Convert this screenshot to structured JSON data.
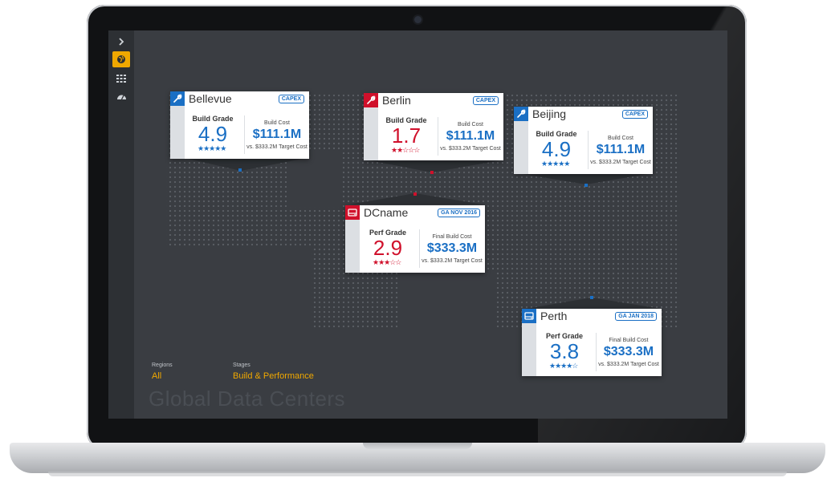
{
  "colors": {
    "accent": "#f0a800",
    "blue": "#1a6fc4",
    "red": "#d0102b",
    "screen_bg": "#3a3d42"
  },
  "sidebar": {
    "items": [
      {
        "name": "expand",
        "icon": "chevron-right-icon"
      },
      {
        "name": "globe",
        "icon": "globe-icon",
        "active": true
      },
      {
        "name": "grid",
        "icon": "grid-icon"
      },
      {
        "name": "dashboard",
        "icon": "gauge-icon"
      }
    ]
  },
  "filters": {
    "regions_label": "Regions",
    "regions_value": "All",
    "stages_label": "Stages",
    "stages_value": "Build & Performance"
  },
  "page_title": "Global Data Centers",
  "cards": [
    {
      "name": "Bellevue",
      "tag": "CAPEX",
      "icon": "wrench-icon",
      "grade_label": "Build Grade",
      "grade": "4.9",
      "stars": "★★★★★",
      "stars_filled": 4.5,
      "cost_label": "Build Cost",
      "cost": "$111.1M",
      "target": "vs. $333.2M Target Cost",
      "status": "good"
    },
    {
      "name": "Berlin",
      "tag": "CAPEX",
      "icon": "wrench-icon",
      "grade_label": "Build Grade",
      "grade": "1.7",
      "stars": "★★☆☆☆",
      "stars_filled": 1.5,
      "cost_label": "Build Cost",
      "cost": "$111.1M",
      "target": "vs. $333.2M Target Cost",
      "status": "bad"
    },
    {
      "name": "Beijing",
      "tag": "CAPEX",
      "icon": "wrench-icon",
      "grade_label": "Build Grade",
      "grade": "4.9",
      "stars": "★★★★★",
      "stars_filled": 4.5,
      "cost_label": "Build Cost",
      "cost": "$111.1M",
      "target": "vs. $333.2M Target Cost",
      "status": "good"
    },
    {
      "name": "DCname",
      "tag": "GA NOV 2016",
      "icon": "server-icon",
      "grade_label": "Perf Grade",
      "grade": "2.9",
      "stars": "★★★☆☆",
      "stars_filled": 2.5,
      "cost_label": "Final Build Cost",
      "cost": "$333.3M",
      "target": "vs. $333.2M Target Cost",
      "status": "bad"
    },
    {
      "name": "Perth",
      "tag": "GA JAN 2018",
      "icon": "server-icon",
      "grade_label": "Perf Grade",
      "grade": "3.8",
      "stars": "★★★★☆",
      "stars_filled": 3.5,
      "cost_label": "Final Build Cost",
      "cost": "$333.3M",
      "target": "vs. $333.2M Target Cost",
      "status": "good"
    }
  ]
}
